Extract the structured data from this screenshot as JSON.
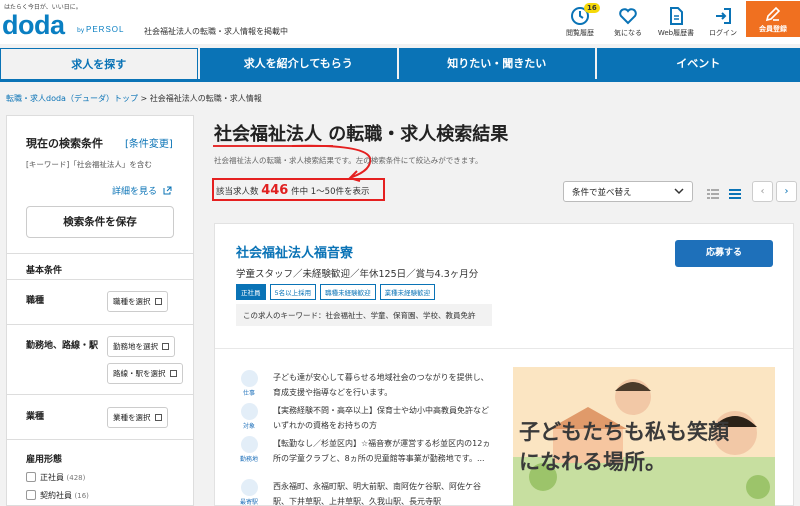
{
  "header": {
    "tagline": "はたらく今日が、いい日に。",
    "logo": "doda",
    "logo_by": "by",
    "logo_brand": "PERSOL",
    "subtitle": "社会福祉法人の転職・求人情報を掲載中",
    "nav": [
      {
        "label": "閲覧履歴",
        "badge": "16",
        "icon": "clock-icon"
      },
      {
        "label": "気になる",
        "icon": "heart-icon"
      },
      {
        "label": "Web履歴書",
        "icon": "document-icon"
      },
      {
        "label": "ログイン",
        "icon": "login-icon"
      }
    ],
    "register_label": "会員登録"
  },
  "tabs": [
    {
      "label": "求人を探す"
    },
    {
      "label": "求人を紹介してもらう"
    },
    {
      "label": "知りたい・聞きたい"
    },
    {
      "label": "イベント"
    }
  ],
  "breadcrumb": {
    "link": "転職・求人doda（デューダ）トップ",
    "separator": ">",
    "current": "社会福祉法人の転職・求人情報"
  },
  "sidebar": {
    "current_conditions": "現在の検索条件",
    "change_conditions": "[条件変更]",
    "keyword_condition": "[キーワード]「社会福祉法人」を含む",
    "see_details": "詳細を見る",
    "save_conditions": "検索条件を保存",
    "basic_conditions": "基本条件",
    "occupation": "職種",
    "occupation_button": "職種を選択",
    "location": "勤務地、路線・駅",
    "location_button": "勤務地を選択",
    "station_button": "路線・駅を選択",
    "industry": "業種",
    "industry_button": "業種を選択",
    "employment": "雇用形態",
    "employment_options": [
      {
        "label": "正社員",
        "count": "(428)"
      },
      {
        "label": "契約社員",
        "count": "(16)"
      }
    ]
  },
  "main": {
    "title_keyword": "社会福祉法人",
    "title_rest": " の転職・求人検索結果",
    "description": "社会福祉法人の転職・求人検索結果です。左の検索条件にて絞込みができます。",
    "count_prefix": "該当求人数",
    "count_value": "446",
    "count_suffix": "件中 1〜50件を表示",
    "sort_label": "条件で並べ替え"
  },
  "job": {
    "company": "社会福祉法人福音寮",
    "subtitle": "学童スタッフ／未経験歓迎／年休125日／賞与4.3ヶ月分",
    "tags": [
      "正社員",
      "5名以上採用",
      "職種未経験歓迎",
      "業種未経験歓迎"
    ],
    "keywords": "この求人のキーワード：社会福祉士、学童、保育園、学校、教員免許",
    "apply_label": "応募する",
    "details": [
      {
        "icon_label": "仕事",
        "text": "子ども達が安心して暮らせる地域社会のつながりを提供し、育成支援や指導などを行います。"
      },
      {
        "icon_label": "対象",
        "text": "【実務経験不問・高卒以上】保育士や幼小中高教員免許などいずれかの資格をお持ちの方"
      },
      {
        "icon_label": "勤務地",
        "text": "【転勤なし／杉並区内】☆福音寮が運営する杉並区内の12ヵ所の学童クラブと、8ヵ所の児童館等事業が勤務地です。..."
      },
      {
        "icon_label": "最寄駅",
        "text": "西永福町、永福町駅、明大前駅、南阿佐ケ谷駅、阿佐ケ谷駅、下井草駅、上井草駅、久我山駅、長元寺駅"
      }
    ],
    "photo_text": "子どもたちも私も笑顔になれる場所。"
  }
}
